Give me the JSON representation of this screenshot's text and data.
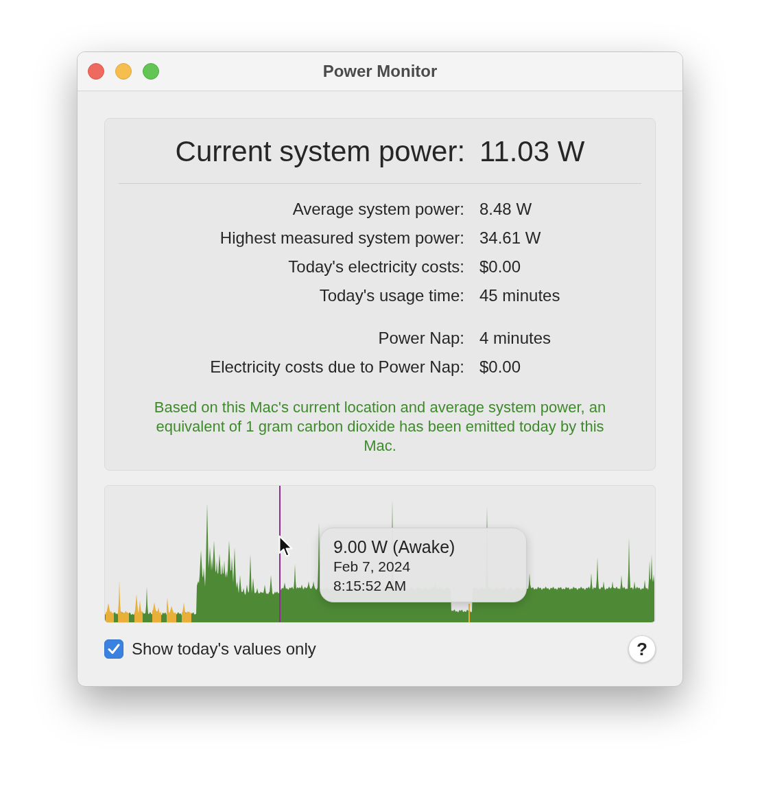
{
  "window": {
    "title": "Power Monitor"
  },
  "summary": {
    "label": "Current system power:",
    "value": "11.03 W"
  },
  "stat_groups": [
    {
      "rows": [
        {
          "label": "Average system power:",
          "value": "8.48 W"
        },
        {
          "label": "Highest measured system power:",
          "value": "34.61 W"
        },
        {
          "label": "Today's electricity costs:",
          "value": "$0.00"
        },
        {
          "label": "Today's usage time:",
          "value": "45 minutes"
        }
      ]
    },
    {
      "rows": [
        {
          "label": "Power Nap:",
          "value": "4 minutes"
        },
        {
          "label": "Electricity costs due to Power Nap:",
          "value": "$0.00"
        }
      ]
    }
  ],
  "note": "Based on this Mac's current location and average system power, an equivalent of 1 gram carbon dioxide has been emitted today by this Mac.",
  "graph": {
    "tooltip": {
      "reading": "9.00 W (Awake)",
      "date": "Feb 7, 2024",
      "time": "8:15:52 AM"
    }
  },
  "checkbox": {
    "label": "Show today's values only",
    "checked": true
  },
  "help_button": {
    "label": "?"
  }
}
